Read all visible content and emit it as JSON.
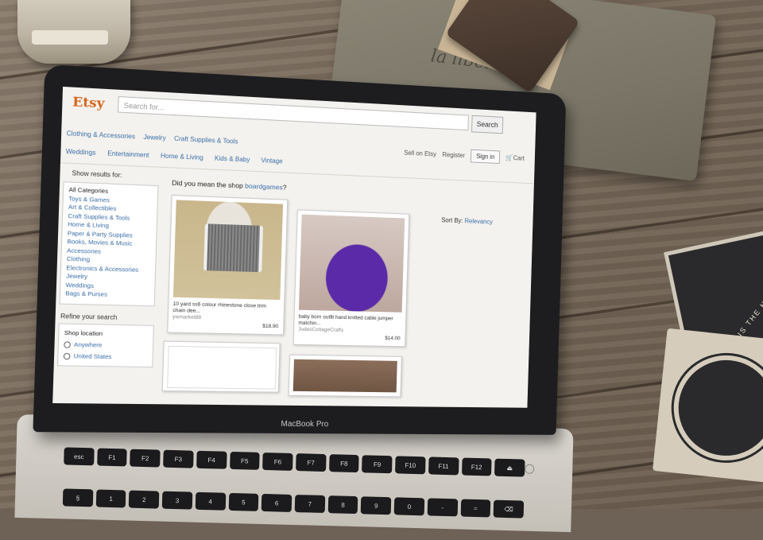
{
  "scene": {
    "jar_label": "",
    "pouch_brand": "la libellule",
    "coaster_text": "HOME IS THE HEART OF THE HOLIDAYS",
    "laptop_label": "MacBook Pro"
  },
  "etsy": {
    "logo": "Etsy",
    "search": {
      "placeholder": "Search for...",
      "button": "Search"
    },
    "account": {
      "sell": "Sell on Etsy",
      "register": "Register",
      "signin": "Sign in",
      "cart": "Cart"
    },
    "categories_top": [
      "Clothing & Accessories",
      "Jewelry",
      "Craft Supplies & Tools",
      "Weddings",
      "Entertainment",
      "Home & Living",
      "Kids & Baby",
      "Vintage"
    ],
    "sidebar": {
      "title": "Show results for:",
      "categories": [
        "All Categories",
        "Toys & Games",
        "Art & Collectibles",
        "Craft Supplies & Tools",
        "Home & Living",
        "Paper & Party Supplies",
        "Books, Movies & Music",
        "Accessories",
        "Clothing",
        "Electronics & Accessories",
        "Jewelry",
        "Weddings",
        "Bags & Purses"
      ],
      "refine": "Refine your search",
      "shop_location": "Shop location",
      "locations": [
        "Anywhere",
        "United States"
      ]
    },
    "results": {
      "didyoumean_prefix": "Did you mean the shop ",
      "didyoumean_link": "boardgames",
      "didyoumean_suffix": "?",
      "sort_label": "Sort By: ",
      "sort_value": "Relevancy",
      "items": [
        {
          "title": "10 yard ss6 colour rhinestone close trim chain dee...",
          "shop": "ywmarket88",
          "price": "$18.90"
        },
        {
          "title": "baby born outfit hand knitted cable jumper matchin...",
          "shop": "JudesCottageCrafts",
          "price": "$14.00"
        }
      ]
    }
  },
  "keyboard": {
    "row1": [
      "esc",
      "F1",
      "F2",
      "F3",
      "F4",
      "F5",
      "F6",
      "F7",
      "F8",
      "F9",
      "F10",
      "F11",
      "F12",
      "⏏"
    ],
    "row2": [
      "§",
      "1",
      "2",
      "3",
      "4",
      "5",
      "6",
      "7",
      "8",
      "9",
      "0",
      "-",
      "=",
      "⌫"
    ]
  }
}
